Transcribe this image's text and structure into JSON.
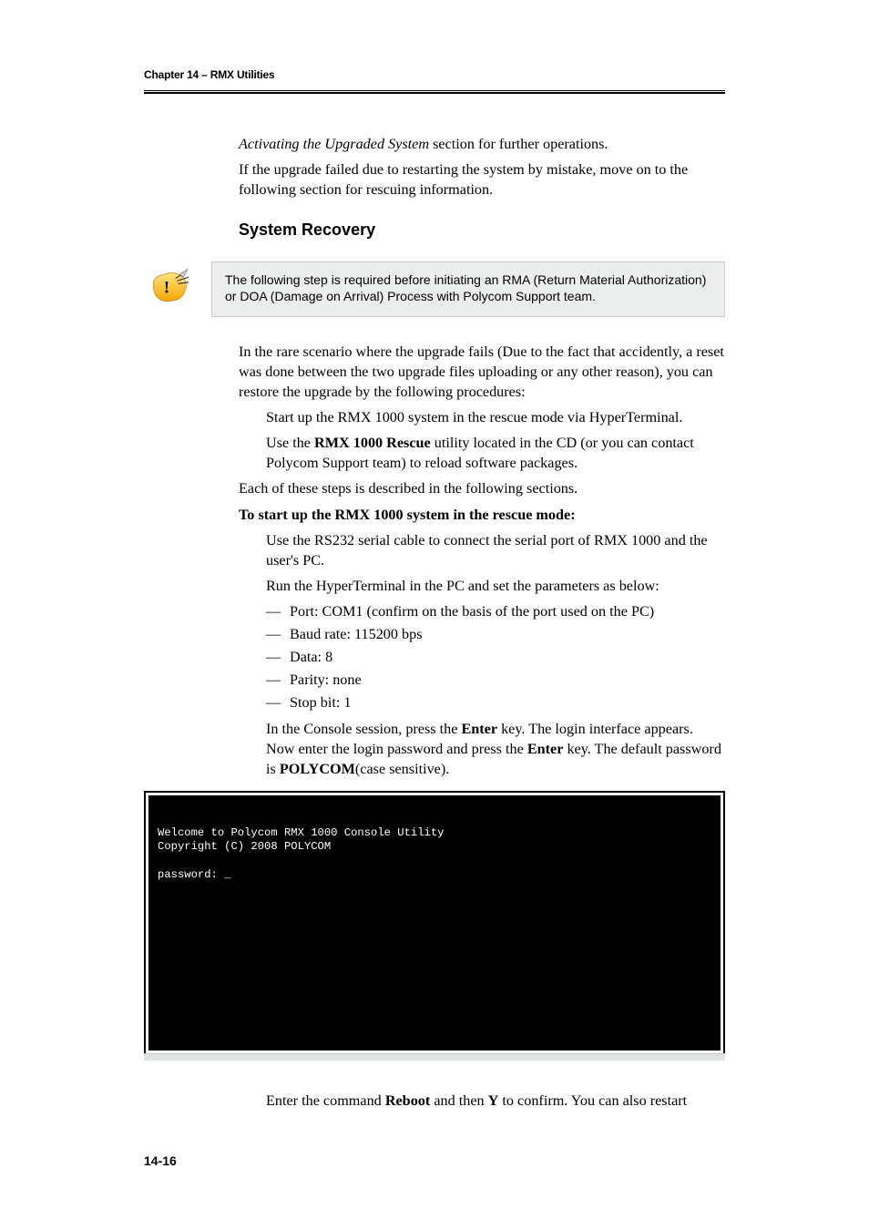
{
  "chapter": "Chapter 14 – RMX Utilities",
  "intro": {
    "line1_pre": "Activating the Upgraded System",
    "line1_post": " section for further operations.",
    "line2": "If the upgrade failed due to restarting the system by mistake, move on to the following section for rescuing information."
  },
  "heading": "System Recovery",
  "callout": "The following step is required before initiating an RMA (Return Material Authorization) or DOA (Damage on Arrival) Process with Polycom Support team.",
  "para1": "In the rare scenario where the upgrade fails (Due to the fact that accidently, a reset was done between the two upgrade files uploading or any other reason), you can restore the upgrade by the following procedures:",
  "step_a": "Start up the RMX 1000 system in the rescue mode via HyperTerminal.",
  "step_b_pre": "Use the ",
  "step_b_bold": "RMX 1000 Rescue",
  "step_b_post": " utility located in the CD (or you can contact Polycom Support team) to reload software packages.",
  "para2": "Each of these steps is described in the following sections.",
  "sub1": "To start up the RMX 1000 system in the rescue mode:",
  "s1a": "Use the RS232 serial cable to connect the serial port of RMX 1000 and the user's PC.",
  "s1b": "Run the HyperTerminal in the PC and set the parameters as below:",
  "params": [
    "Port: COM1 (confirm on the basis of the port used on the PC)",
    "Baud rate: 115200 bps",
    "Data: 8",
    "Parity: none",
    "Stop bit: 1"
  ],
  "s1c_pre": "In the Console session, press the ",
  "s1c_b1": "Enter",
  "s1c_mid": " key. The login interface appears. Now enter the login password and press the ",
  "s1c_b2": "Enter",
  "s1c_mid2": " key. The default password is ",
  "s1c_b3": "POLYCOM",
  "s1c_post": "(case sensitive).",
  "console": "Welcome to Polycom RMX 1000 Console Utility\nCopyright (C) 2008 POLYCOM\n\npassword: _",
  "s1d_pre": "Enter the command ",
  "s1d_b1": "Reboot",
  "s1d_mid": " and then ",
  "s1d_b2": "Y",
  "s1d_post": " to confirm. You can also restart",
  "page_num": "14-16"
}
